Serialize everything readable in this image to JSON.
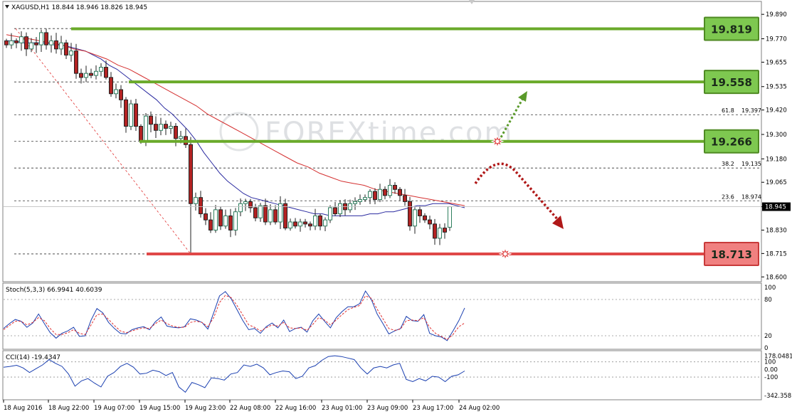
{
  "header": {
    "symbol_line": "XAGUSD,H1  18.844 18.946 18.826 18.945"
  },
  "watermark": "FOREXtime.com",
  "colors": {
    "bull_candle": "#2f7f5f",
    "bear_candle": "#b22222",
    "ma_fast": "#2a2aa0",
    "ma_slow": "#d43030",
    "green_level": "#6aaa2a",
    "red_level": "#e04848",
    "badge_green_fill": "#7ec850",
    "badge_red_fill": "#f08080",
    "arrow_up": "#5a9a2a",
    "arrow_down": "#b01818"
  },
  "chart_data": [
    {
      "type": "candlestick",
      "title": "XAGUSD,H1",
      "ohlc_readout": {
        "open": 18.844,
        "high": 18.946,
        "low": 18.826,
        "close": 18.945
      },
      "ylim": [
        18.58,
        19.95
      ],
      "y_ticks": [
        19.89,
        19.77,
        19.655,
        19.535,
        19.42,
        19.3,
        19.18,
        19.065,
        18.945,
        18.83,
        18.715,
        18.6
      ],
      "y_tick_labels": [
        "19.890",
        "19.770",
        "19.655",
        "19.535",
        "19.420",
        "19.300",
        "19.180",
        "19.065",
        "18.945",
        "18.830",
        "18.715",
        "18.600"
      ],
      "x_tick_labels": [
        "18 Aug 2016",
        "18 Aug 22:00",
        "19 Aug 07:00",
        "19 Aug 15:00",
        "19 Aug 23:00",
        "22 Aug 08:00",
        "22 Aug 16:00",
        "23 Aug 01:00",
        "23 Aug 09:00",
        "23 Aug 17:00",
        "24 Aug 02:00"
      ],
      "current_price": 18.945,
      "current_price_label": "18.945",
      "close_prices": [
        19.74,
        19.76,
        19.75,
        19.78,
        19.72,
        19.75,
        19.74,
        19.8,
        19.74,
        19.76,
        19.72,
        19.75,
        19.69,
        19.71,
        19.6,
        19.58,
        19.6,
        19.59,
        19.61,
        19.63,
        19.58,
        19.5,
        19.52,
        19.47,
        19.34,
        19.45,
        19.34,
        19.27,
        19.39,
        19.35,
        19.32,
        19.35,
        19.33,
        19.34,
        19.28,
        19.29,
        19.25,
        18.96,
        18.99,
        18.91,
        18.88,
        18.83,
        18.93,
        18.85,
        18.9,
        18.83,
        18.92,
        18.96,
        18.97,
        18.94,
        18.89,
        18.95,
        18.87,
        18.93,
        18.87,
        18.96,
        18.84,
        18.87,
        18.85,
        18.87,
        18.86,
        18.85,
        18.9,
        18.85,
        18.88,
        18.94,
        18.91,
        18.96,
        18.93,
        18.96,
        18.97,
        18.98,
        18.99,
        19.02,
        18.98,
        19.03,
        19.0,
        19.05,
        19.03,
        19.0,
        18.97,
        18.85,
        18.93,
        18.9,
        18.88,
        18.86,
        18.79,
        18.84,
        18.82,
        18.945
      ],
      "ma_fast_values": [
        19.76,
        19.76,
        19.75,
        19.75,
        19.75,
        19.75,
        19.74,
        19.74,
        19.73,
        19.72,
        19.71,
        19.69,
        19.67,
        19.64,
        19.62,
        19.59,
        19.56,
        19.53,
        19.5,
        19.47,
        19.43,
        19.4,
        19.36,
        19.32,
        19.27,
        19.21,
        19.16,
        19.11,
        19.07,
        19.04,
        19.01,
        18.99,
        18.98,
        18.97,
        18.96,
        18.95,
        18.94,
        18.93,
        18.92,
        18.91,
        18.91,
        18.9,
        18.9,
        18.9,
        18.9,
        18.9,
        18.91,
        18.91,
        18.92,
        18.92,
        18.93,
        18.94,
        18.95,
        18.95,
        18.96,
        18.96,
        18.96,
        18.95,
        18.94
      ],
      "ma_slow_values": [
        19.79,
        19.78,
        19.77,
        19.76,
        19.75,
        19.74,
        19.72,
        19.71,
        19.69,
        19.67,
        19.64,
        19.62,
        19.59,
        19.56,
        19.53,
        19.5,
        19.47,
        19.44,
        19.4,
        19.37,
        19.34,
        19.31,
        19.28,
        19.25,
        19.22,
        19.19,
        19.16,
        19.14,
        19.11,
        19.09,
        19.07,
        19.06,
        19.05,
        19.03,
        19.02,
        19.01,
        19.0,
        18.99,
        18.98,
        18.97,
        18.96,
        18.95
      ],
      "horizontal_levels": [
        {
          "value": 19.819,
          "label": "19.819",
          "kind": "resistance",
          "color": "green"
        },
        {
          "value": 19.558,
          "label": "19.558",
          "kind": "resistance",
          "color": "green"
        },
        {
          "value": 19.266,
          "label": "19.266",
          "kind": "pivot",
          "color": "green"
        },
        {
          "value": 18.713,
          "label": "18.713",
          "kind": "support",
          "color": "red"
        }
      ],
      "fibonacci": [
        {
          "ratio": "61.8",
          "value": 19.397,
          "label": "61.8",
          "value_label": "19.397"
        },
        {
          "ratio": "38.2",
          "value": 19.135,
          "label": "38.2",
          "value_label": "19.135"
        },
        {
          "ratio": "23.6",
          "value": 18.974,
          "label": "23.6",
          "value_label": "18.974"
        }
      ],
      "fib_swing": {
        "high": 19.82,
        "low": 18.713
      },
      "scenarios": [
        {
          "direction": "up",
          "color": "green"
        },
        {
          "direction": "down",
          "color": "red"
        }
      ]
    },
    {
      "type": "line",
      "title": "Stoch(5,3,3) 66.9941 40.6039",
      "series": [
        {
          "name": "",
          "values": [
            32,
            40,
            47,
            44,
            34,
            41,
            56,
            40,
            25,
            16,
            24,
            28,
            34,
            19,
            20,
            46,
            65,
            58,
            42,
            32,
            24,
            23,
            30,
            33,
            35,
            30,
            43,
            51,
            36,
            34,
            33,
            35,
            48,
            46,
            42,
            31,
            58,
            86,
            93,
            81,
            63,
            45,
            30,
            32,
            24,
            35,
            41,
            33,
            46,
            27,
            32,
            34,
            26,
            45,
            56,
            44,
            33,
            50,
            60,
            68,
            68,
            73,
            94,
            80,
            56,
            40,
            23,
            28,
            32,
            52,
            45,
            44,
            55,
            24,
            20,
            18,
            12,
            28,
            45,
            66
          ]
        },
        {
          "name": "",
          "values": [
            30,
            37,
            44,
            44,
            38,
            42,
            50,
            45,
            32,
            22,
            22,
            25,
            30,
            24,
            22,
            38,
            55,
            56,
            47,
            37,
            28,
            25,
            28,
            31,
            33,
            32,
            40,
            46,
            40,
            36,
            34,
            34,
            42,
            44,
            42,
            35,
            50,
            75,
            87,
            83,
            70,
            54,
            38,
            34,
            28,
            33,
            38,
            36,
            42,
            33,
            32,
            33,
            29,
            39,
            50,
            46,
            38,
            46,
            55,
            63,
            67,
            70,
            86,
            82,
            64,
            48,
            32,
            29,
            31,
            45,
            46,
            45,
            50,
            34,
            24,
            19,
            14,
            22,
            35,
            41
          ]
        }
      ],
      "ylim": [
        0,
        100
      ],
      "y_tick_labels": [
        "100",
        "80",
        "20",
        "0"
      ],
      "y_tick_values": [
        100,
        80,
        20,
        0
      ]
    },
    {
      "type": "line",
      "title": "CCI(14) -19.4347",
      "series": [
        {
          "name": "",
          "values": [
            30,
            40,
            55,
            20,
            -40,
            10,
            60,
            130,
            80,
            40,
            -60,
            -220,
            -150,
            -120,
            -180,
            -230,
            -90,
            -40,
            40,
            80,
            30,
            -60,
            -50,
            -10,
            -30,
            -80,
            -40,
            -230,
            -300,
            -170,
            -200,
            -240,
            -110,
            -120,
            -140,
            -60,
            -40,
            60,
            40,
            70,
            20,
            -70,
            -40,
            -20,
            -30,
            -120,
            -90,
            20,
            50,
            120,
            170,
            180,
            170,
            150,
            130,
            20,
            -60,
            20,
            40,
            20,
            60,
            80,
            -130,
            -160,
            -120,
            -150,
            -90,
            -100,
            -160,
            -90,
            -70,
            -19.43
          ]
        }
      ],
      "ylim": [
        -380,
        200
      ],
      "y_tick_labels": [
        "178.0481",
        "100",
        "0.00",
        "-100",
        "-342.358"
      ],
      "y_tick_values": [
        178.0481,
        100,
        0,
        -100,
        -342.358
      ]
    }
  ]
}
